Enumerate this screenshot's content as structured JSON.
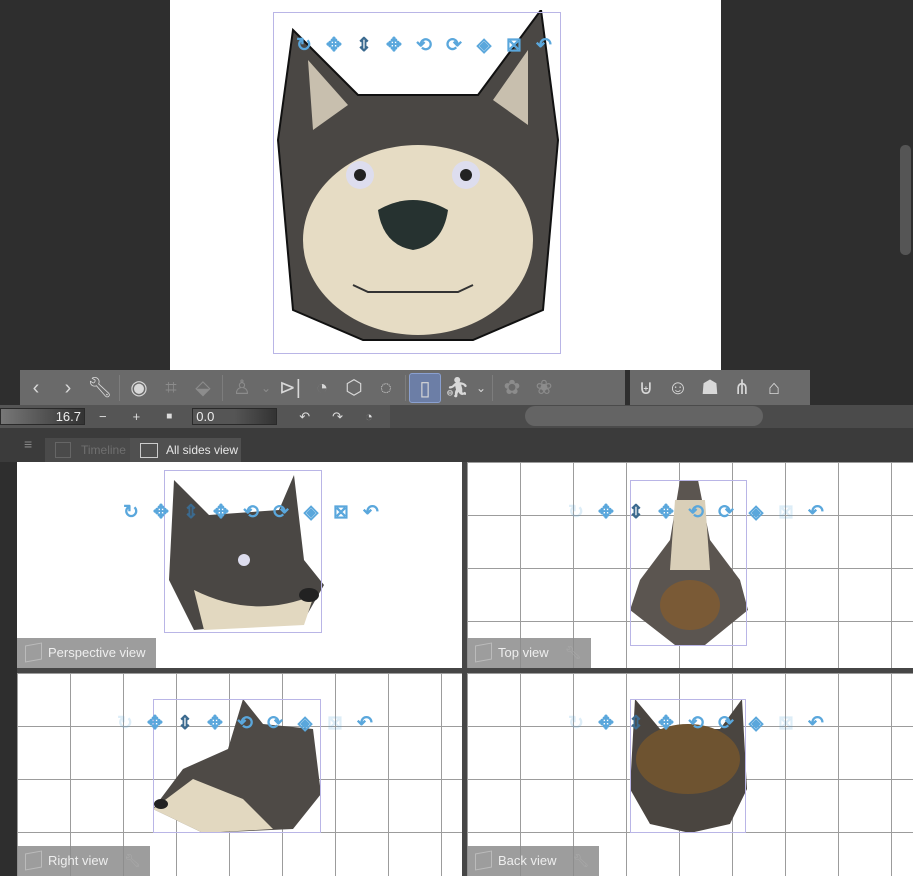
{
  "toolbar": {
    "icons": [
      "chevron-left-icon",
      "chevron-right-icon",
      "wrench-icon",
      "camera-icon",
      "fit-frame-icon",
      "ground-icon",
      "add-pose-icon",
      "chevron-down-icon",
      "flip-icon",
      "reset-rotation-icon",
      "reset-model-icon",
      "rotate-around-icon",
      "frame-icon",
      "pose-figure-icon",
      "chevron-down-icon",
      "plant-icon",
      "plant-arm-icon"
    ],
    "right_icons": [
      "body-icon",
      "face-icon",
      "hair-icon",
      "torso-icon",
      "bag-icon"
    ]
  },
  "controls": {
    "zoom_value": "16.7",
    "minus": "−",
    "plus": "+",
    "angle_value": "0.0"
  },
  "tabs": {
    "menu": "≡",
    "timeline": "Timeline",
    "all_sides": "All sides view"
  },
  "views": {
    "perspective": "Perspective view",
    "top": "Top view",
    "right": "Right view",
    "back": "Back view"
  },
  "colors": {
    "accent": "#5aa7dc",
    "canvas": "#ffffff",
    "panel": "#6a6a6a"
  }
}
